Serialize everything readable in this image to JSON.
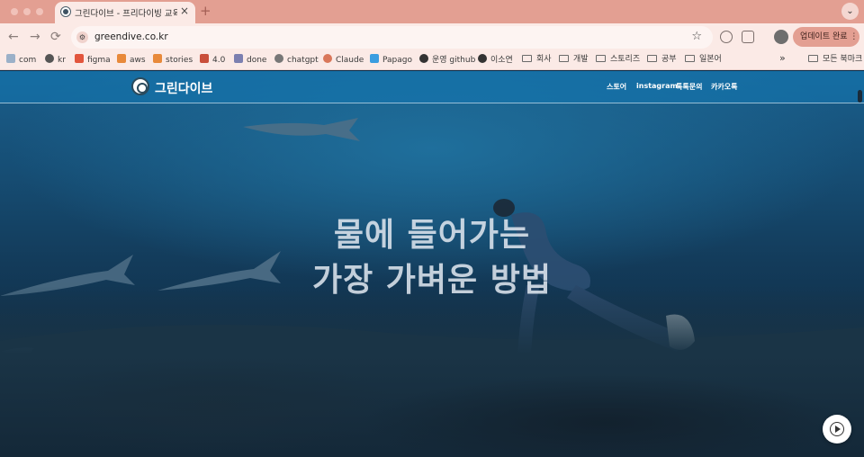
{
  "browser": {
    "tab_title": "그린다이브 - 프리다이빙 교육",
    "tab_close": "×",
    "new_tab": "+",
    "tab_menu": "⌄",
    "back": "←",
    "forward": "→",
    "reload": "⟳",
    "url": "greendive.co.kr",
    "star": "☆",
    "update_button": "업데이트 완료 ⋮"
  },
  "bookmarks": {
    "items": [
      {
        "label": "com",
        "icon": "keyboard-icon",
        "color": "#9bb0c8"
      },
      {
        "label": "kr",
        "icon": "globe-icon",
        "color": "#555555"
      },
      {
        "label": "figma",
        "icon": "figma-icon",
        "color": "#e2553c"
      },
      {
        "label": "aws",
        "icon": "cube-icon",
        "color": "#e8893a"
      },
      {
        "label": "stories",
        "icon": "cube-icon",
        "color": "#e8893a"
      },
      {
        "label": "4.0",
        "icon": "app-icon",
        "color": "#c94f3b"
      },
      {
        "label": "done",
        "icon": "sync-icon",
        "color": "#7b7fb0"
      },
      {
        "label": "chatgpt",
        "icon": "openai-icon",
        "color": "#777777"
      },
      {
        "label": "Claude",
        "icon": "claude-icon",
        "color": "#d9775a"
      },
      {
        "label": "Papago",
        "icon": "papago-icon",
        "color": "#3a9de0"
      },
      {
        "label": "운영 github",
        "icon": "github-icon",
        "color": "#333333"
      },
      {
        "label": "이소연",
        "icon": "github-icon",
        "color": "#333333"
      },
      {
        "label": "회사",
        "icon": "folder-icon"
      },
      {
        "label": "개발",
        "icon": "folder-icon"
      },
      {
        "label": "스토리즈",
        "icon": "folder-icon"
      },
      {
        "label": "공부",
        "icon": "folder-icon"
      },
      {
        "label": "일본어",
        "icon": "folder-icon"
      }
    ],
    "overflow": "»",
    "all_bookmarks": "모든 북마크"
  },
  "site": {
    "logo_text": "그린다이브",
    "nav": [
      "스토어",
      "instagram",
      "톡톡문의",
      "카카오톡"
    ],
    "hero_line1": "물에 들어가는",
    "hero_line2": "가장 가벼운 방법"
  },
  "colors": {
    "tabbar": "#e39f92",
    "chrome": "#fbeae6",
    "header": "#1278b4"
  }
}
